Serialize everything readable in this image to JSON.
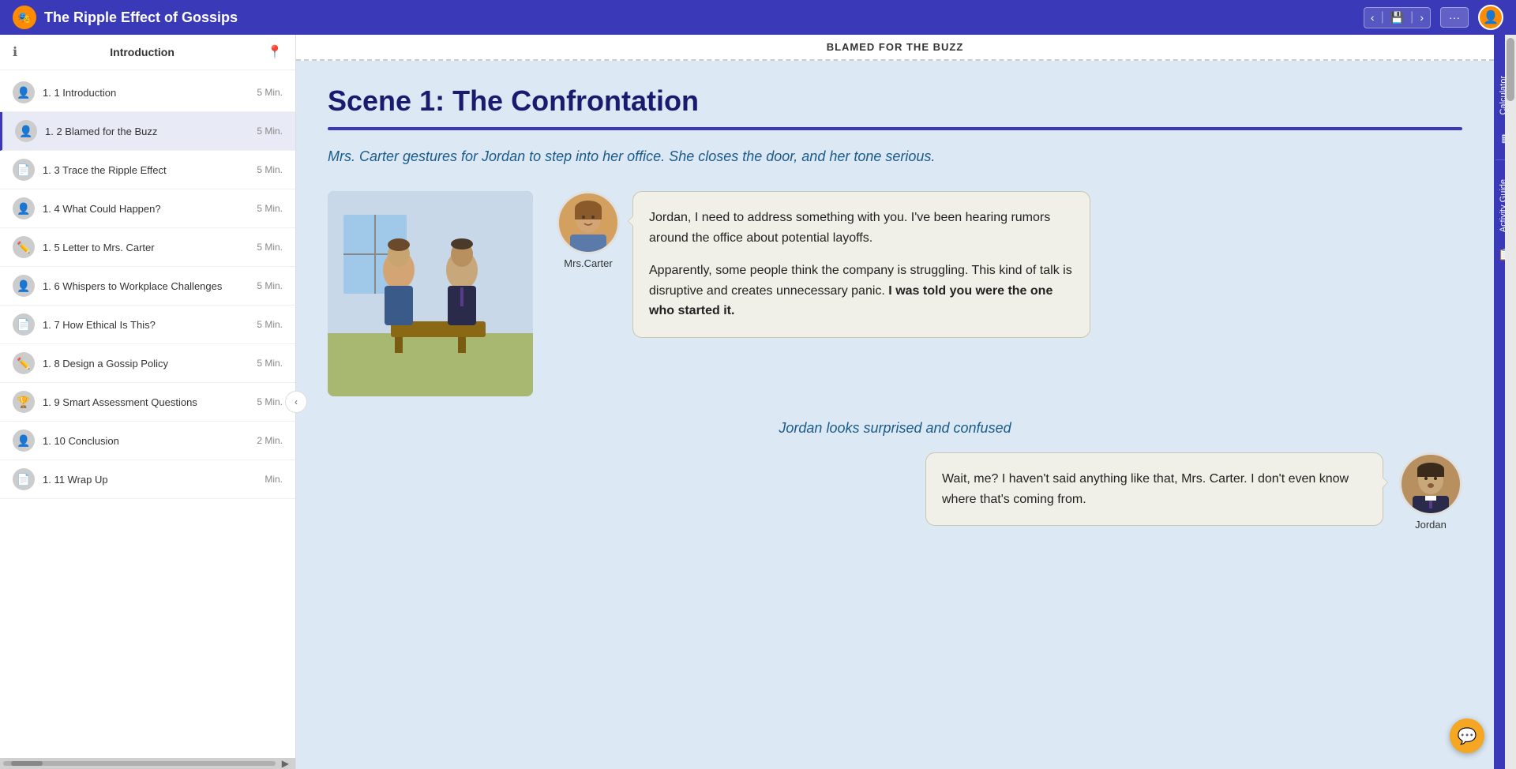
{
  "header": {
    "title": "The Ripple Effect of Gossips",
    "logo_char": "🎭",
    "nav_prev": "‹",
    "nav_next": "›",
    "menu_dots": "···",
    "save_icon": "💾"
  },
  "sidebar": {
    "header_title": "Introduction",
    "items": [
      {
        "id": "1-1",
        "icon": "👤",
        "label": "1. 1 Introduction",
        "time": "5 Min.",
        "active": false
      },
      {
        "id": "1-2",
        "icon": "👤",
        "label": "1. 2 Blamed for the Buzz",
        "time": "5 Min.",
        "active": true
      },
      {
        "id": "1-3",
        "icon": "📄",
        "label": "1. 3 Trace the Ripple Effect",
        "time": "5 Min.",
        "active": false
      },
      {
        "id": "1-4",
        "icon": "👤",
        "label": "1. 4 What Could Happen?",
        "time": "5 Min.",
        "active": false
      },
      {
        "id": "1-5",
        "icon": "✏️",
        "label": "1. 5 Letter to Mrs. Carter",
        "time": "5 Min.",
        "active": false
      },
      {
        "id": "1-6",
        "icon": "👤",
        "label": "1. 6 Whispers to Workplace Challenges",
        "time": "5 Min.",
        "active": false
      },
      {
        "id": "1-7",
        "icon": "📄",
        "label": "1. 7 How Ethical Is This?",
        "time": "5 Min.",
        "active": false
      },
      {
        "id": "1-8",
        "icon": "✏️",
        "label": "1. 8 Design a Gossip Policy",
        "time": "5 Min.",
        "active": false
      },
      {
        "id": "1-9",
        "icon": "🏆",
        "label": "1. 9 Smart Assessment Questions",
        "time": "5 Min.",
        "active": false
      },
      {
        "id": "1-10",
        "icon": "👤",
        "label": "1. 10 Conclusion",
        "time": "2 Min.",
        "active": false
      },
      {
        "id": "1-11",
        "icon": "📄",
        "label": "1. 11 Wrap Up",
        "time": "Min.",
        "active": false
      }
    ]
  },
  "content": {
    "page_header": "BLAMED FOR THE BUZZ",
    "scene_title": "Scene 1: The Confrontation",
    "scene_intro": "Mrs. Carter gestures for Jordan to step into her office. She closes the door, and her tone serious.",
    "mrs_carter_name": "Mrs.Carter",
    "jordan_name": "Jordan",
    "mrs_carter_speech_p1": "Jordan, I need to address something with you. I've been hearing rumors around the office about potential layoffs.",
    "mrs_carter_speech_p2": "Apparently, some people think the company is struggling. This kind of talk is disruptive and creates unnecessary panic.",
    "mrs_carter_speech_bold": "I was told you were the one who started it.",
    "scene_action": "Jordan looks surprised and confused",
    "jordan_speech": "Wait, me? I haven't said anything like that, Mrs. Carter. I don't even know where that's coming from.",
    "right_panel_calculator": "Calculator",
    "right_panel_activity": "Activity Guide"
  }
}
